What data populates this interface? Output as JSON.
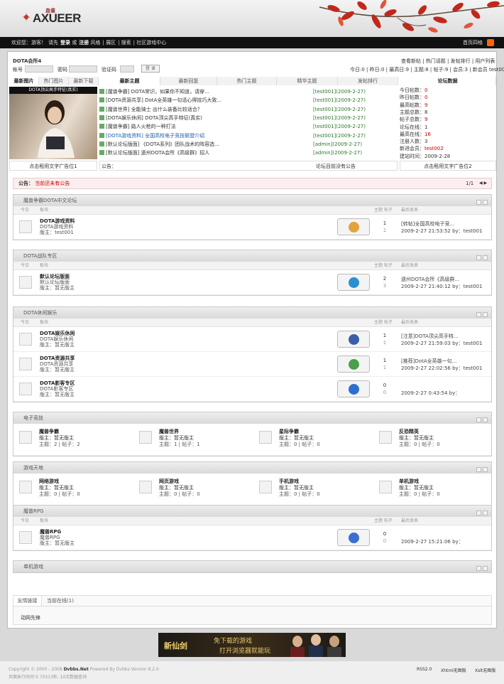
{
  "header": {
    "logo_text": "AXUEER",
    "logo_cn": "血雀"
  },
  "nav": {
    "welcome": "欢迎您：游客！",
    "please": "请先",
    "login": "登录",
    "or": "或",
    "register": "注册",
    "items": [
      "风格",
      "展区",
      "搜索",
      "社区游戏中心"
    ],
    "right": "首页四格"
  },
  "forum_name": "DOTA会所4",
  "login_form": {
    "account_label": "帐号",
    "password_label": "密码",
    "captcha_label": "验证码",
    "submit": "登 录"
  },
  "toplinks": "查看新帖 | 热门话题 | 发帖排行 | 用户列表",
  "stats_line": "今日:0 | 昨日:0 | 最高日:9 | 主题:8 | 帖子:9 | 会员:3 | 新会员",
  "newest_member": "test002",
  "left_tabs": [
    "最新图片",
    "热门图片",
    "最新下载"
  ],
  "photo_title": "DOTA顶尖高手特征(真实)",
  "center_tabs": [
    "最新主题",
    "最新回复",
    "热门主题",
    "精华主题",
    "发帖排行"
  ],
  "stats_tab": "论坛数据",
  "topics": [
    {
      "title": "[魔兽争霸] DOTA常识，如果你不知道，请穿...",
      "user": "[test001]",
      "date": "(2009-2-27)"
    },
    {
      "title": "[DOTA资源共享] DotA全英雄一句话心得技巧大致...",
      "user": "[test001]",
      "date": "(2009-2-27)"
    },
    {
      "title": "[魔兽世界] 全能骑士 出什么装备比较适合？",
      "user": "[test001]",
      "date": "(2009-2-27)"
    },
    {
      "title": "[DOTA娱乐休闲] DOTA顶尖高手特征(真实)",
      "user": "[test001]",
      "date": "(2009-2-27)"
    },
    {
      "title": "[魔兽争霸] 路人火枪的一种打法",
      "user": "[test001]",
      "date": "(2009-2-27)"
    },
    {
      "title": "[DOTA游戏资料] 全国高校电子竞技联盟介绍",
      "user": "[test001]",
      "date": "(2009-2-27)"
    },
    {
      "title": "[默认论坛版面] 《DOTA系列》团队战术的阵容选...",
      "user": "[admin]",
      "date": "(2009-2-27)"
    },
    {
      "title": "[默认论坛版面] 遗州DOTA会所《高级群》招人",
      "user": "[admin]",
      "date": "(2009-2-27)"
    }
  ],
  "stats": [
    {
      "label": "今日帖数：",
      "value": "0",
      "red": true
    },
    {
      "label": "昨日帖数：",
      "value": "0",
      "red": true
    },
    {
      "label": "最高帖数：",
      "value": "9",
      "red": true
    },
    {
      "label": "主题总数：",
      "value": "8",
      "red": false
    },
    {
      "label": "帖子总数：",
      "value": "9",
      "red": true
    },
    {
      "label": "论坛在线：",
      "value": "1",
      "red": false
    },
    {
      "label": "最高在线：",
      "value": "16",
      "red": true
    },
    {
      "label": "注册人数：",
      "value": "3",
      "red": false
    },
    {
      "label": "新进会员：",
      "value": "test002",
      "red": true
    },
    {
      "label": "建站时间：",
      "value": "2009-2-28",
      "red": false
    }
  ],
  "adbar": {
    "left": "点击租用文字广告位1",
    "notice_label": "公告：",
    "center": "论坛目前没有公告",
    "right": "点击租用文字广告位2"
  },
  "notice": {
    "label": "公告：",
    "text": "当前还未有公告",
    "page": "1/1"
  },
  "col_headers": {
    "today": "今日",
    "board": "板块",
    "topic_post": "主题 帖子",
    "last_post": "最后发表"
  },
  "sections": [
    {
      "title": "魔兽争霸DOTA中文论坛",
      "boards": [
        {
          "name": "DOTA游戏资料",
          "desc": "DOTA游戏资料",
          "moderator": "版主：test001",
          "topics": "1",
          "posts": "1",
          "last_title": "[转帖]全国高校电子竞...",
          "last_info": "2009-2-27 21:53:52 by：test001",
          "icon_color": "#e2a33b"
        }
      ]
    },
    {
      "title": "DOTA战队专区",
      "boards": [
        {
          "name": "默认论坛版面",
          "desc": "默认论坛版面",
          "moderator": "版主：暂无版主",
          "topics": "2",
          "posts": "3",
          "last_title": "遗州DOTA会所《高级群...",
          "last_info": "2009-2-27 21:40:12 by：test001",
          "icon_color": "#2b8fd1"
        }
      ]
    },
    {
      "title": "DOTA休闲娱乐",
      "boards": [
        {
          "name": "DOTA娱乐休闲",
          "desc": "DOTA娱乐休闲",
          "moderator": "版主：暂无版主",
          "topics": "1",
          "posts": "1",
          "last_title": "[注意]DOTA顶尖高手特...",
          "last_info": "2009-2-27 21:59:03 by：test001",
          "icon_color": "#3a5fa8"
        },
        {
          "name": "DOTA资源共享",
          "desc": "DOTA资源共享",
          "moderator": "版主：暂无版主",
          "topics": "1",
          "posts": "1",
          "last_title": "[推荐]DotA全英雄一句...",
          "last_info": "2009-2-27 22:02:56 by：test001",
          "icon_color": "#4aa04a"
        },
        {
          "name": "DOTA影客专区",
          "desc": "DOTA影客专区",
          "moderator": "版主：暂无版主",
          "topics": "0",
          "posts": "0",
          "last_title": "",
          "last_info": "2009-2-27 0:43:54 by：",
          "icon_color": "#2d6fd1"
        }
      ]
    },
    {
      "title": "电子竞技",
      "cells": [
        {
          "name": "魔兽争霸",
          "moderator": "版主：暂无版主",
          "counts": "主题：2 | 帖子：2"
        },
        {
          "name": "魔兽世界",
          "moderator": "版主：暂无版主",
          "counts": "主题：1 | 帖子：1"
        },
        {
          "name": "星际争霸",
          "moderator": "版主：暂无版主",
          "counts": "主题：0 | 帖子：0"
        },
        {
          "name": "反恐精英",
          "moderator": "版主：暂无版主",
          "counts": "主题：0 | 帖子：0"
        }
      ]
    },
    {
      "title": "游戏天地",
      "cells": [
        {
          "name": "网络游戏",
          "moderator": "版主：暂无版主",
          "counts": "主题：0 | 帖子：0"
        },
        {
          "name": "网页游戏",
          "moderator": "版主：暂无版主",
          "counts": "主题：0 | 帖子：0"
        },
        {
          "name": "手机游戏",
          "moderator": "版主：暂无版主",
          "counts": "主题：0 | 帖子：0"
        },
        {
          "name": "单机游戏",
          "moderator": "版主：暂无版主",
          "counts": "主题：0 | 帖子：0"
        }
      ]
    },
    {
      "title": "魔兽RPG",
      "boards": [
        {
          "name": "魔兽RPG",
          "desc": "魔兽RPG",
          "moderator": "版主：暂无版主",
          "topics": "0",
          "posts": "0",
          "last_title": "",
          "last_info": "2009-2-27 15:21:06 by：",
          "icon_color": "#3a6fd1"
        }
      ]
    },
    {
      "title": "单机游戏"
    }
  ],
  "bottom_tabs": [
    "友情链接",
    "当前在线(1)"
  ],
  "bottom_text": "动网先锋",
  "ad": {
    "line1": "免下载的游戏",
    "line2": "打开浏览器就能玩",
    "brand": "新仙剑"
  },
  "footer": {
    "copyright": "Copyright © 2000 - 2008",
    "brand": "Dvbbs.Net",
    "powered": "Powered By Dvbbs Version 8.2.0",
    "runtime": "页面执行时间 0.70313秒, 10次数据查询",
    "links": [
      "RSS2.0",
      "Xhtml无图版",
      "Xslt无图版"
    ]
  },
  "colors": {
    "accent_red": "#cc0000",
    "link_green": "#2b7a2b",
    "nav_bg": "#111111"
  }
}
